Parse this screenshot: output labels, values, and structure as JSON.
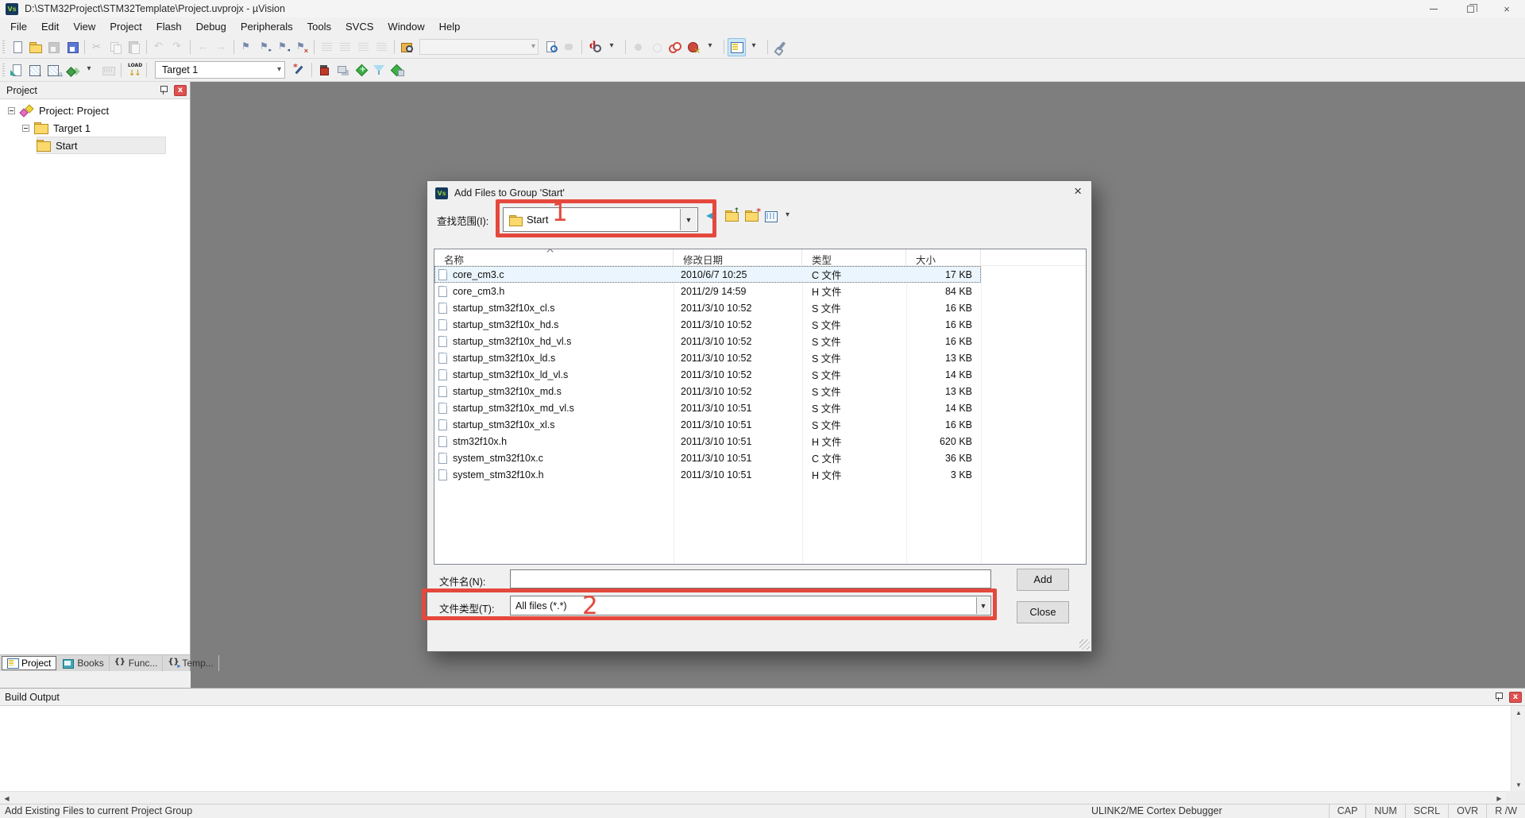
{
  "window": {
    "title": "D:\\STM32Project\\STM32Template\\Project.uvprojx - µVision",
    "controls": [
      "minimize",
      "restore",
      "close"
    ]
  },
  "menubar": {
    "items": [
      "File",
      "Edit",
      "View",
      "Project",
      "Flash",
      "Debug",
      "Peripherals",
      "Tools",
      "SVCS",
      "Window",
      "Help"
    ]
  },
  "toolbar1": {
    "items": [
      {
        "n": "new-file"
      },
      {
        "n": "open-folder"
      },
      {
        "n": "save",
        "d": 1
      },
      {
        "n": "save-all"
      },
      "sep",
      {
        "n": "cut",
        "d": 1
      },
      {
        "n": "copy",
        "d": 1
      },
      {
        "n": "paste",
        "d": 1
      },
      "sep",
      {
        "n": "undo",
        "d": 1
      },
      {
        "n": "redo",
        "d": 1
      },
      "sep",
      {
        "n": "nav-back",
        "d": 1
      },
      {
        "n": "nav-forward",
        "d": 1
      },
      "sep",
      {
        "n": "bookmark-toggle"
      },
      {
        "n": "bookmark-next"
      },
      {
        "n": "bookmark-prev"
      },
      {
        "n": "bookmark-clear"
      },
      "sep",
      {
        "n": "indent",
        "d": 1
      },
      {
        "n": "outdent",
        "d": 1
      },
      {
        "n": "comment",
        "d": 1
      },
      {
        "n": "uncomment",
        "d": 1
      },
      "sep",
      {
        "n": "find-in-files"
      },
      "search",
      {
        "n": "find-next"
      },
      {
        "n": "browse",
        "d": 1
      },
      "sep",
      {
        "n": "debug-search"
      },
      {
        "n": "caret"
      },
      "sep",
      {
        "n": "breakpoint-gray",
        "d": 1
      },
      {
        "n": "breakpoint-outline",
        "d": 1
      },
      {
        "n": "breakpoint-toggle"
      },
      {
        "n": "kill-breakpoints"
      },
      {
        "n": "caret"
      },
      "sep",
      {
        "n": "window-layout",
        "hl": 1
      },
      {
        "n": "caret"
      },
      "sep",
      {
        "n": "configure"
      }
    ],
    "search_value": ""
  },
  "toolbar2": {
    "items": [
      {
        "n": "translate"
      },
      {
        "n": "build"
      },
      {
        "n": "rebuild"
      },
      {
        "n": "batch-build"
      },
      {
        "n": "caret"
      },
      {
        "n": "stop-build",
        "d": 1
      },
      "sep",
      {
        "n": "download"
      },
      "sep",
      "target-combo",
      {
        "n": "target-options"
      },
      "sep",
      {
        "n": "manage-project-items"
      },
      {
        "n": "multi-project"
      },
      {
        "n": "manage-rte"
      },
      {
        "n": "select-packs"
      },
      {
        "n": "pack-installer"
      }
    ],
    "target_select": "Target 1"
  },
  "project_panel": {
    "title": "Project",
    "tree": [
      {
        "label": "Project: Project",
        "level": 0,
        "icon": "project",
        "expand": true,
        "selected": false
      },
      {
        "label": "Target 1",
        "level": 1,
        "icon": "folder",
        "expand": true,
        "selected": false
      },
      {
        "label": "Start",
        "level": 2,
        "icon": "folder",
        "expand": false,
        "selected": true
      }
    ],
    "tabs": [
      {
        "label": "Project",
        "icon": "project",
        "active": true
      },
      {
        "label": "Books",
        "icon": "books",
        "active": false
      },
      {
        "label": "Func...",
        "icon": "braces",
        "active": false
      },
      {
        "label": "Temp...",
        "icon": "braces-arrow",
        "active": false
      }
    ]
  },
  "dialog": {
    "title": "Add Files to Group 'Start'",
    "look_in_label": "查找范围(I):",
    "look_in_value": "Start",
    "nav_icons": [
      "dlg-back",
      "dlg-up",
      "dlg-newfolder",
      "dlg-views",
      "caret"
    ],
    "columns": [
      "名称",
      "修改日期",
      "类型",
      "大小"
    ],
    "files": [
      {
        "name": "core_cm3.c",
        "date": "2010/6/7 10:25",
        "type": "C 文件",
        "size": "17 KB",
        "selected": true
      },
      {
        "name": "core_cm3.h",
        "date": "2011/2/9 14:59",
        "type": "H 文件",
        "size": "84 KB",
        "selected": false
      },
      {
        "name": "startup_stm32f10x_cl.s",
        "date": "2011/3/10 10:52",
        "type": "S 文件",
        "size": "16 KB",
        "selected": false
      },
      {
        "name": "startup_stm32f10x_hd.s",
        "date": "2011/3/10 10:52",
        "type": "S 文件",
        "size": "16 KB",
        "selected": false
      },
      {
        "name": "startup_stm32f10x_hd_vl.s",
        "date": "2011/3/10 10:52",
        "type": "S 文件",
        "size": "16 KB",
        "selected": false
      },
      {
        "name": "startup_stm32f10x_ld.s",
        "date": "2011/3/10 10:52",
        "type": "S 文件",
        "size": "13 KB",
        "selected": false
      },
      {
        "name": "startup_stm32f10x_ld_vl.s",
        "date": "2011/3/10 10:52",
        "type": "S 文件",
        "size": "14 KB",
        "selected": false
      },
      {
        "name": "startup_stm32f10x_md.s",
        "date": "2011/3/10 10:52",
        "type": "S 文件",
        "size": "13 KB",
        "selected": false
      },
      {
        "name": "startup_stm32f10x_md_vl.s",
        "date": "2011/3/10 10:51",
        "type": "S 文件",
        "size": "14 KB",
        "selected": false
      },
      {
        "name": "startup_stm32f10x_xl.s",
        "date": "2011/3/10 10:51",
        "type": "S 文件",
        "size": "16 KB",
        "selected": false
      },
      {
        "name": "stm32f10x.h",
        "date": "2011/3/10 10:51",
        "type": "H 文件",
        "size": "620 KB",
        "selected": false
      },
      {
        "name": "system_stm32f10x.c",
        "date": "2011/3/10 10:51",
        "type": "C 文件",
        "size": "36 KB",
        "selected": false
      },
      {
        "name": "system_stm32f10x.h",
        "date": "2011/3/10 10:51",
        "type": "H 文件",
        "size": "3 KB",
        "selected": false
      }
    ],
    "file_name_label": "文件名(N):",
    "file_name_value": "",
    "file_type_label": "文件类型(T):",
    "file_type_value": "All files (*.*)",
    "add_button": "Add",
    "close_button": "Close"
  },
  "annotations": {
    "color": "#e5483d",
    "step1": "1",
    "step2": "2"
  },
  "build_output": {
    "title": "Build Output",
    "content": ""
  },
  "statusbar": {
    "message": "Add Existing Files to current Project Group",
    "debugger": "ULINK2/ME Cortex Debugger",
    "flags": [
      "CAP",
      "NUM",
      "SCRL",
      "OVR",
      "R /W"
    ]
  }
}
